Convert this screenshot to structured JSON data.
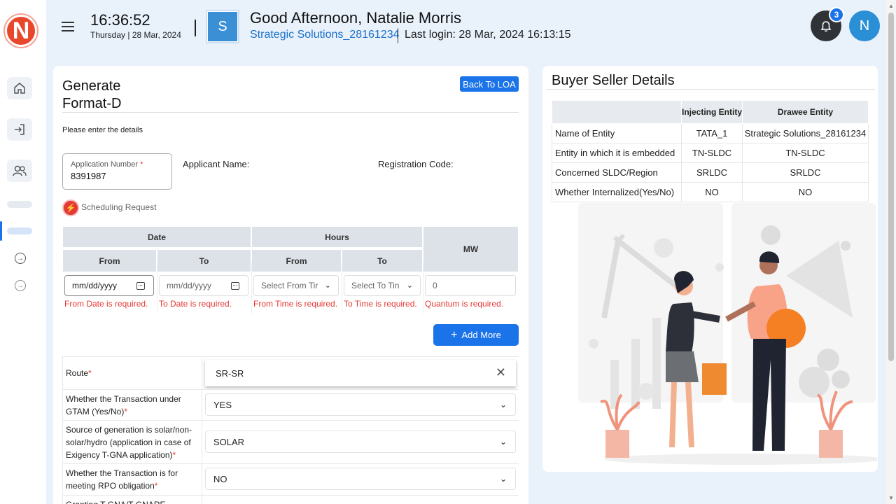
{
  "sidebar": {
    "logo_letter": "N",
    "items": [
      {
        "icon": "home-icon"
      },
      {
        "icon": "login-icon"
      },
      {
        "icon": "users-icon"
      }
    ]
  },
  "header": {
    "time": "16:36:52",
    "day": "Thursday |",
    "date": "28 Mar, 2024",
    "org_letter": "S",
    "greeting": "Good Afternoon, Natalie Morris",
    "org_name": "Strategic Solutions_28161234",
    "last_login": "Last login: 28 Mar, 2024 16:13:15",
    "notification_count": "3",
    "avatar_letter": "N"
  },
  "form": {
    "title_line1": "Generate",
    "title_line2": "Format-D",
    "back_button": "Back To LOA",
    "subtitle": "Please enter the details",
    "application_number_label": "Application Number",
    "application_number_required": "*",
    "application_number": "8391987",
    "applicant_name_label": "Applicant Name:",
    "registration_code_label": "Registration Code:",
    "scheduling_label": "Scheduling Request",
    "grid": {
      "date_header": "Date",
      "hours_header": "Hours",
      "mw_header": "MW",
      "from": "From",
      "to": "To",
      "hours_from": "From",
      "hours_to": "To",
      "from_date_placeholder": "mm/dd/yyyy",
      "to_date_placeholder": "mm/dd/yyyy",
      "from_time_placeholder": "Select From Tir",
      "to_time_placeholder": "Select To Tin",
      "mw_value": "0",
      "err_from_date": "From Date is required.",
      "err_to_date": "To Date is required.",
      "err_from_time": "From Time is required.",
      "err_to_time": "To Time is required.",
      "err_quantum": "Quantum is required."
    },
    "add_more": "Add More",
    "fields": {
      "route_label": "Route",
      "route_value": "SR-SR",
      "gtam_label": "Whether the Transaction under GTAM (Yes/No)",
      "gtam_value": "YES",
      "source_label": "Source of generation is solar/non-solar/hydro (application in case of Exigency T-GNA application)",
      "source_value": "SOLAR",
      "rpo_label": "Whether the Transaction is for meeting RPO obligation",
      "rpo_value": "NO",
      "granting_label": "Granting T-GNA/T-GNARE exigency"
    }
  },
  "buyer_seller": {
    "title": "Buyer Seller Details",
    "columns": [
      "",
      "Injecting Entity",
      "Drawee Entity"
    ],
    "rows": [
      [
        "Name of Entity",
        "TATA_1",
        "Strategic Solutions_28161234"
      ],
      [
        "Entity in which it is embedded",
        "TN-SLDC",
        "TN-SLDC"
      ],
      [
        "Concerned SLDC/Region",
        "SRLDC",
        "SRLDC"
      ],
      [
        "Whether Internalized(Yes/No)",
        "NO",
        "NO"
      ]
    ]
  }
}
